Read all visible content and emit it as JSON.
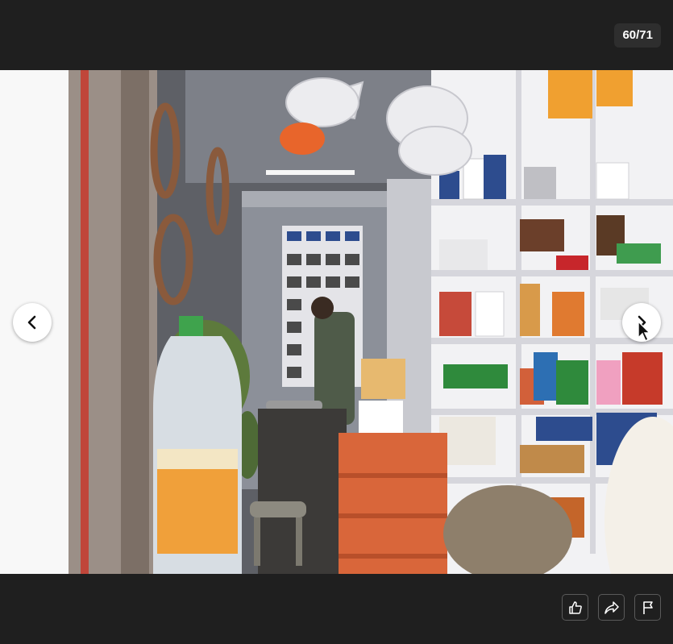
{
  "viewer": {
    "counter": "60/71",
    "photo_alt": "",
    "photo_subject": "hardware-store-interior",
    "nav": {
      "previous_icon": "chevron-left-icon",
      "next_icon": "chevron-right-icon"
    },
    "actions": [
      {
        "icon": "thumbs-up-icon"
      },
      {
        "icon": "share-icon"
      },
      {
        "icon": "flag-icon"
      }
    ]
  },
  "colors": {
    "background": "#1f1f1f",
    "counter_bg": "#2e2e2e",
    "text": "#ffffff",
    "button_border": "#5a5a5a",
    "carton_orange": "#d9663a",
    "shelf_white": "#f2f2f4"
  }
}
